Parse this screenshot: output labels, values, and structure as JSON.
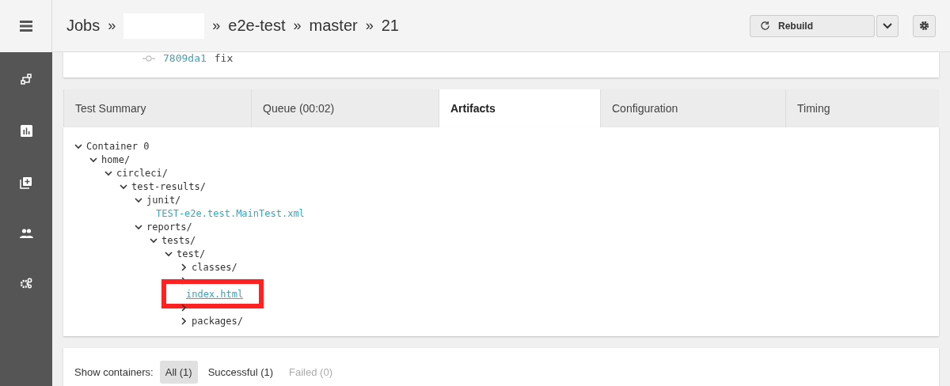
{
  "header": {
    "breadcrumbs": [
      {
        "label": "Jobs",
        "redacted": false
      },
      {
        "redacted": true
      },
      {
        "label": "e2e-test",
        "redacted": false
      },
      {
        "label": "master",
        "redacted": false
      },
      {
        "label": "21",
        "redacted": false
      }
    ],
    "separator": "»",
    "rebuild": "Rebuild"
  },
  "commit": {
    "hash": "7809da1",
    "message": "fix"
  },
  "tabs": [
    {
      "label": "Test Summary",
      "selected": false
    },
    {
      "label": "Queue (00:02)",
      "selected": false
    },
    {
      "label": "Artifacts",
      "selected": true
    },
    {
      "label": "Configuration",
      "selected": false
    },
    {
      "label": "Timing",
      "selected": false
    }
  ],
  "tree": [
    {
      "kind": "folder",
      "label": "Container 0",
      "expanded": true,
      "children": [
        {
          "kind": "folder",
          "label": "home/",
          "expanded": true,
          "children": [
            {
              "kind": "folder",
              "label": "circleci/",
              "expanded": true,
              "children": [
                {
                  "kind": "folder",
                  "label": "test-results/",
                  "expanded": true,
                  "children": [
                    {
                      "kind": "folder",
                      "label": "junit/",
                      "expanded": true,
                      "children": [
                        {
                          "kind": "file",
                          "label": "TEST-e2e.test.MainTest.xml"
                        }
                      ]
                    },
                    {
                      "kind": "folder",
                      "label": "reports/",
                      "expanded": true,
                      "children": [
                        {
                          "kind": "folder",
                          "label": "tests/",
                          "expanded": true,
                          "children": [
                            {
                              "kind": "folder",
                              "label": "test/",
                              "expanded": true,
                              "children": [
                                {
                                  "kind": "folder",
                                  "label": "classes/",
                                  "expanded": false
                                },
                                {
                                  "kind": "folder",
                                  "expanded": false
                                },
                                {
                                  "kind": "file",
                                  "label": "index.html",
                                  "highlighted": true
                                },
                                {
                                  "kind": "folder",
                                  "expanded": false
                                },
                                {
                                  "kind": "folder",
                                  "label": "packages/",
                                  "expanded": false
                                }
                              ]
                            }
                          ]
                        }
                      ]
                    }
                  ]
                }
              ]
            }
          ]
        }
      ]
    }
  ],
  "filter": {
    "label": "Show containers:",
    "options": [
      {
        "label": "All (1)",
        "selected": true,
        "disabled": false
      },
      {
        "label": "Successful (1)",
        "selected": false,
        "disabled": false
      },
      {
        "label": "Failed (0)",
        "selected": false,
        "disabled": true
      }
    ]
  }
}
